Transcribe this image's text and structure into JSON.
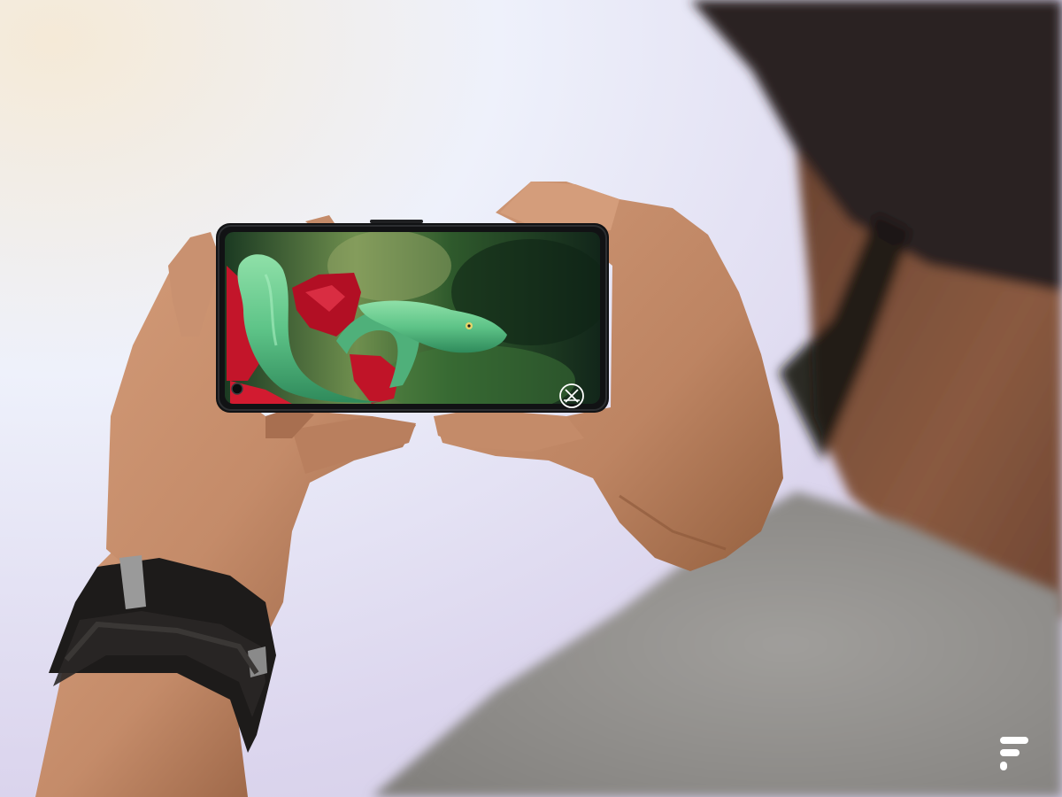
{
  "photo": {
    "subject": "person-holding-smartphone-landscape",
    "screen_content": "green-viper-snake-on-red-flower",
    "colors": {
      "background_light": "#eef1fb",
      "background_lavender": "#d7d0ea",
      "background_warm": "#f5ead7",
      "skin": "#c68f6d",
      "skin_shadow": "#8e5a3f",
      "shirt": "#8d8b88",
      "hair": "#2b2420",
      "phone_frame": "#111214",
      "snake_green": "#5fc58a",
      "flower_red": "#c3152a",
      "watch_strap": "#1d1b1a"
    }
  },
  "screen_overlay": {
    "icon": "crossed-tools-icon"
  },
  "watermark": {
    "icon": "brand-logo-icon"
  }
}
